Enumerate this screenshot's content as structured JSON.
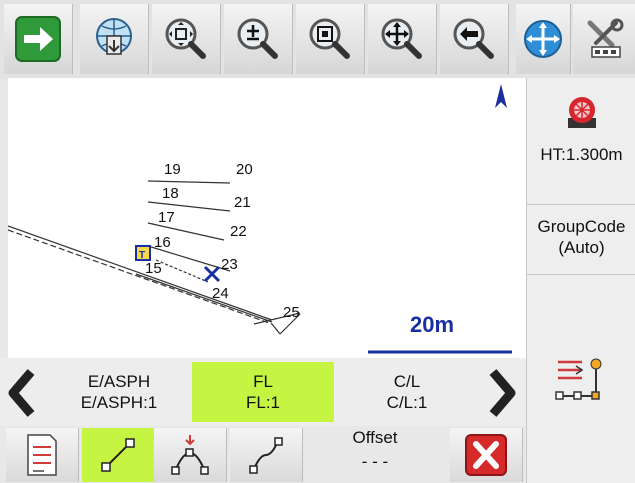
{
  "toolbar": {
    "items": [
      {
        "name": "next-arrow-icon"
      },
      {
        "name": "globe-download-icon"
      },
      {
        "name": "zoom-extents-icon"
      },
      {
        "name": "zoom-in-out-icon"
      },
      {
        "name": "zoom-window-icon"
      },
      {
        "name": "pan-icon"
      },
      {
        "name": "zoom-previous-icon"
      }
    ]
  },
  "right_panel": {
    "ht_label": "HT:1.300m",
    "group_code_title": "GroupCode",
    "group_code_value": "(Auto)"
  },
  "map": {
    "north_symbol": "north-arrow-icon",
    "point_labels": [
      "19",
      "20",
      "18",
      "21",
      "17",
      "22",
      "16",
      "15",
      "23",
      "24",
      "25"
    ],
    "marker_label": "T",
    "scale_label": "20m"
  },
  "code_bar": {
    "codes": [
      {
        "line1": "E/ASPH",
        "line2": "E/ASPH:1"
      },
      {
        "line1": "FL",
        "line2": "FL:1"
      },
      {
        "line1": "C/L",
        "line2": "C/L:1"
      }
    ]
  },
  "bottom_bar": {
    "offset_label": "Offset",
    "offset_value": "- - -"
  },
  "colors": {
    "active": "#c6f442",
    "scale": "#1a2fa0",
    "close": "#d62a2a"
  }
}
